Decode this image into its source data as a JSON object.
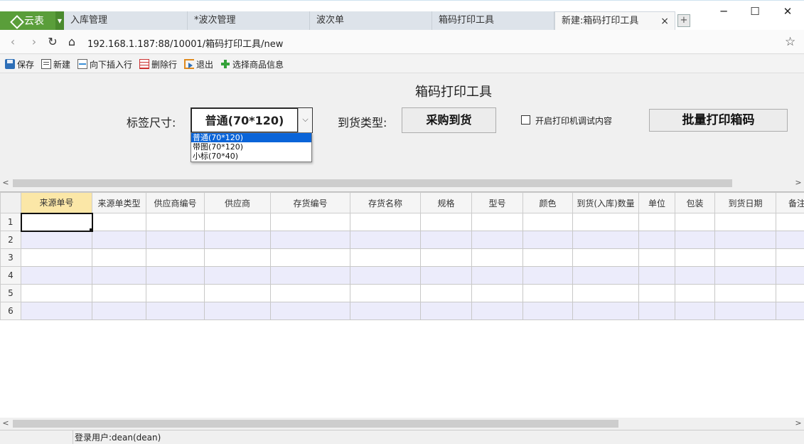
{
  "browser": {
    "brand_name": "云表",
    "tabs": [
      {
        "label": "入库管理"
      },
      {
        "label": "*波次管理"
      },
      {
        "label": "波次单"
      },
      {
        "label": "箱码打印工具"
      },
      {
        "label": "新建:箱码打印工具",
        "close": "×"
      }
    ],
    "newtab_glyph": "+",
    "window": {
      "minimize": "─",
      "maximize": "☐",
      "close": "✕"
    },
    "url": "192.168.1.187:88/10001/箱码打印工具/new"
  },
  "toolbar": {
    "save": "保存",
    "new": "新建",
    "insert_below": "向下插入行",
    "delete_row": "删除行",
    "exit": "退出",
    "select_goods": "选择商品信息"
  },
  "form": {
    "title": "箱码打印工具",
    "label_size_label": "标签尺寸:",
    "label_size_value": "普通(70*120)",
    "label_size_options": [
      "普通(70*120)",
      "带图(70*120)",
      "小标(70*40)"
    ],
    "arrival_type_label": "到货类型:",
    "arrival_type_value": "采购到货",
    "printer_debug_label": "开启打印机调试内容",
    "printer_debug_checked": false,
    "batch_print_label": "批量打印箱码"
  },
  "grid": {
    "columns": [
      "来源单号",
      "来源单类型",
      "供应商编号",
      "供应商",
      "存货编号",
      "存货名称",
      "规格",
      "型号",
      "颜色",
      "到货(入库)数量",
      "单位",
      "包装",
      "到货日期",
      "备注"
    ],
    "row_numbers": [
      "1",
      "2",
      "3",
      "4",
      "5",
      "6"
    ]
  },
  "status": {
    "login_user": "登录用户:dean(dean)"
  },
  "colors": {
    "brand": "#5a9e3a",
    "selected_option": "#0a64d8",
    "header_highlight": "#fbe7a7",
    "alt_row": "#ececfb"
  }
}
